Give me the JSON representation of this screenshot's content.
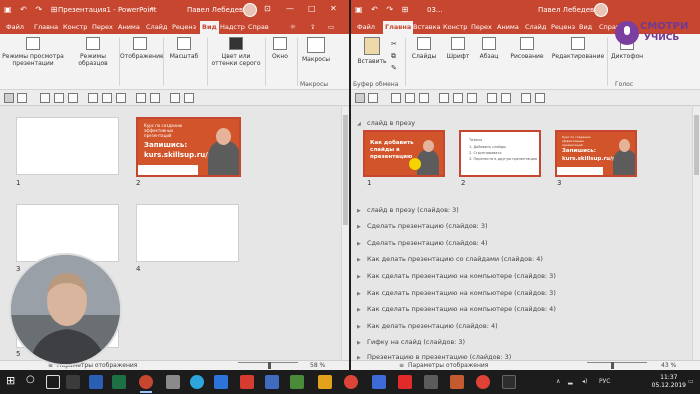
{
  "left_window": {
    "title": "Презентация1 - PowerPoint",
    "user": "Павел Лебедев",
    "tabs": [
      "Файл",
      "Главна",
      "Констр",
      "Перех",
      "Анима",
      "Слайд",
      "Реценз",
      "Вид",
      "Надстр",
      "Справ"
    ],
    "active_tab": "Вид",
    "ribbon": {
      "b1": "Режимы просмотра презентации",
      "b2": "Режимы образцов",
      "b3": "Отображение",
      "b4": "Масштаб",
      "b5": "Цвет или оттенки серого",
      "b6": "Окно",
      "b7": "Макросы",
      "group_macros": "Макросы"
    },
    "slides": [
      "1",
      "2",
      "3",
      "4",
      "5"
    ],
    "slide2": {
      "small": "Курс по созданию эффективных презентаций",
      "big1": "Запишись:",
      "big2": "kurs.skillsup.ru/go"
    },
    "status": {
      "notes": "Параметры отображения",
      "zoom": "58 %"
    }
  },
  "right_window": {
    "title": "03...",
    "user": "Павел Лебедев",
    "tabs": [
      "Файл",
      "Главна",
      "Вставка",
      "Констр",
      "Перех",
      "Анима",
      "Слайд",
      "Реценз",
      "Вид",
      "Справк"
    ],
    "active_tab": "Главна",
    "ribbon": {
      "b1": "Вставить",
      "b2": "Слайды",
      "b3": "Шрифт",
      "b4": "Абзац",
      "b5": "Рисование",
      "b6": "Редактирование",
      "b7": "Диктофон",
      "group_clip": "Буфер обмена",
      "group_voice": "Голос"
    },
    "first_section": "слайд в презу",
    "thumbs": [
      "1",
      "2",
      "3"
    ],
    "thumb1": "Как добавить слайды в презентацию",
    "thumb2_lines": [
      "Тезисы",
      "1. Добавить слайды",
      "2. Сгруппировать",
      "3. Перенести в другую презентацию"
    ],
    "thumb3": {
      "small": "Курс по созданию эффективных презентаций",
      "big1": "Запишись:",
      "big2": "kurs.skillsup.ru/go"
    },
    "sections": [
      "слайд в презу (слайдов: 3)",
      "Сделать презентацию (слайдов: 3)",
      "Сделать презентацию (слайдов: 4)",
      "Как делать презентацию со слайдами (слайдов: 4)",
      "Как сделать презентацию на компьютере (слайдов: 3)",
      "Как сделать презентацию на компьютере (слайдов: 3)",
      "Как сделать презентацию на компьютере (слайдов: 4)",
      "Как делать презентацию (слайдов: 4)",
      "Гифку на слайд (слайдов: 3)",
      "Презентацию в презентацию (слайдов: 3)"
    ],
    "status": {
      "notes": "Параметры отображения",
      "zoom": "43 %"
    }
  },
  "logo": {
    "line1": "СМОТРИ",
    "line2": "УЧИСЬ"
  },
  "taskbar": {
    "time": "11:37",
    "date": "05.12.2019",
    "lang": "РУС"
  },
  "colors": {
    "accent": "#c6462f",
    "slide_orange": "#d2542a",
    "taskbar": "#1c1c1c"
  }
}
